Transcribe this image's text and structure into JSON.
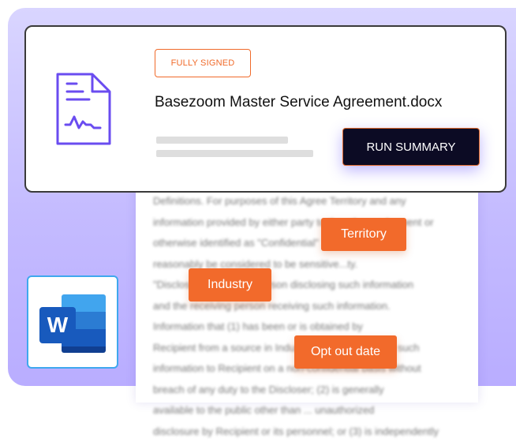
{
  "card": {
    "status_badge": "FULLY SIGNED",
    "filename": "Basezoom Master Service Agreement.docx",
    "run_button": "RUN SUMMARY"
  },
  "document": {
    "body_text": "Definitions. For purposes of this Agree Territory and any\ninformation provided by either party to the other and ...went or\notherwise identified as \"Confidential\" ...ich would\nreasonably be considered to be sensitive...ty.\n\"Discloser\" means the person disclosing such information\nand the receiving person receiving such information.\nInformation that (1) has been or is obtained by\nRecipient from a source in Industry who has provided such\ninformation to Recipient on a non-confidential basis without\nbreach of any duty to the Discloser; (2) is generally\navailable to the public other than ... unauthorized\ndisclosure by Recipient or its personnel; or (3) is independently"
  },
  "tags": {
    "territory": "Territory",
    "industry": "Industry",
    "opt_out_date": "Opt out date"
  },
  "icons": {
    "file": "signed-document-icon",
    "app": "microsoft-word-icon"
  },
  "colors": {
    "accent_orange": "#f26a2b",
    "button_dark": "#0c0b24",
    "icon_purple": "#6a4cf0",
    "background_lavender": "#c4bbff",
    "word_blue": "#185abd"
  }
}
